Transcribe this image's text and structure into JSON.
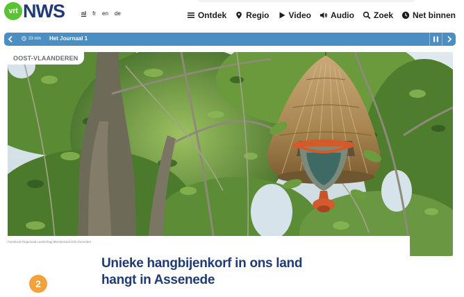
{
  "header": {
    "logo_small": "vrt",
    "logo_main": "NWS",
    "languages": [
      {
        "code": "nl",
        "active": true
      },
      {
        "code": "fr",
        "active": false
      },
      {
        "code": "en",
        "active": false
      },
      {
        "code": "de",
        "active": false
      }
    ],
    "nav": [
      {
        "label": "Ontdek",
        "icon": "menu-icon"
      },
      {
        "label": "Regio",
        "icon": "location-pin-icon"
      },
      {
        "label": "Video",
        "icon": "play-icon"
      },
      {
        "label": "Audio",
        "icon": "speaker-icon"
      },
      {
        "label": "Zoek",
        "icon": "search-icon"
      },
      {
        "label": "Net binnen",
        "icon": "clock-icon"
      }
    ]
  },
  "livebar": {
    "time_ago": "33 min",
    "title": "Het Journaal 1",
    "color": "#4b8ec3"
  },
  "article": {
    "region": "OOST-VLAANDEREN",
    "photo_credit": "Facebook Regionaal Landschap Meetjesland Dirk Dumortier",
    "headline_line1": "Unieke hangbijenkorf in ons land",
    "headline_line2": "hangt in Assenede",
    "radio_badge": "2"
  },
  "colors": {
    "brand_navy": "#1f3b75",
    "brand_green": "#5bc236",
    "radio_orange": "#f3a23b"
  }
}
